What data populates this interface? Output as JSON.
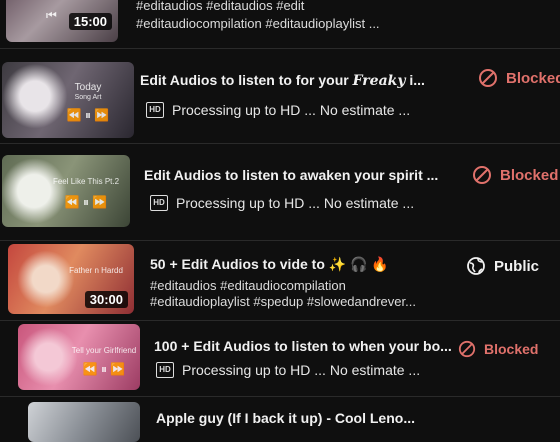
{
  "rows": [
    {
      "tags1": "#editaudios #editaudios #edit",
      "tags2": "#editaudiocompilation #editaudioplaylist ...",
      "duration": "15:00"
    },
    {
      "title_a": "Edit Audios to listen to for your ",
      "title_fancy": "Freaky",
      "title_b": " i...",
      "processing": "Processing up to HD ... No estimate ...",
      "hd": "HD",
      "visibility": "Blocked",
      "thumb_label_1": "Today",
      "thumb_label_2": "Song Art"
    },
    {
      "title": "Edit Audios to listen to awaken your spirit ...",
      "processing": "Processing up to HD ... No estimate ...",
      "hd": "HD",
      "visibility": "Blocked",
      "thumb_label": "Feel Like This Pt.2"
    },
    {
      "title": "50 + Edit Audios to vide to ✨ 🎧 🔥",
      "tags1": "#editaudios #editaudiocompilation",
      "tags2": "#editaudioplaylist #spedup #slowedandrever...",
      "visibility": "Public",
      "duration": "30:00",
      "thumb_label": "Father n Hardd"
    },
    {
      "title": "100 + Edit Audios to listen to when your bo...",
      "processing": "Processing up to HD ... No estimate ...",
      "hd": "HD",
      "visibility": "Blocked",
      "thumb_label": "Tell your Girlfriend"
    },
    {
      "title": "Apple guy (If I back it up) - Cool Leno..."
    }
  ],
  "colors": {
    "blocked": "#e0716b",
    "public": "#f1f1f1",
    "background": "#0f0f0f"
  },
  "icons": {
    "blocked": "blocked-circle-icon",
    "public": "globe-icon",
    "hd": "hd-badge-icon"
  }
}
